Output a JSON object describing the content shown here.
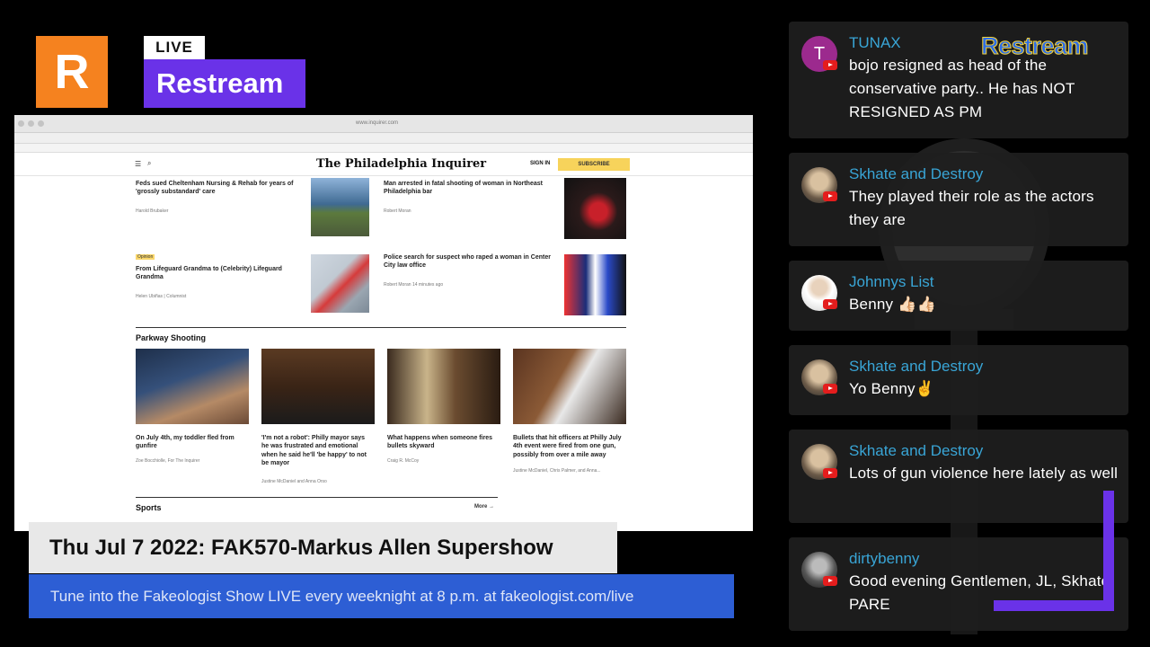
{
  "logo": {
    "letter": "R",
    "live": "LIVE",
    "name": "Restream"
  },
  "browser": {
    "url": "www.inquirer.com",
    "site_title": "The Philadelphia Inquirer",
    "signin": "SIGN IN",
    "subscribe": "SUBSCRIBE",
    "menu_icon": "hamburger-icon",
    "search_icon": "search-icon"
  },
  "articles": {
    "a1": {
      "title": "Feds sued Cheltenham Nursing & Rehab for years of 'grossly substandard' care",
      "byline": "Harold Brubaker"
    },
    "a2": {
      "title": "Man arrested in fatal shooting of woman in Northeast Philadelphia bar",
      "byline": "Robert Moran"
    },
    "a3": {
      "tag": "Opinion",
      "title": "From Lifeguard Grandma to (Celebrity) Lifeguard Grandma",
      "byline": "Helen Ubiñas | Columnist"
    },
    "a4": {
      "title": "Police search for suspect who raped a woman in Center City law office",
      "byline": "Robert Moran 14 minutes ago"
    }
  },
  "parkway": {
    "section": "Parkway Shooting",
    "items": [
      {
        "title": "On July 4th, my toddler fled from gunfire",
        "byline": "Zoe Bocchiolle, For The Inquirer"
      },
      {
        "title": "'I'm not a robot': Philly mayor says he was frustrated and emotional when he said he'll 'be happy' to not be mayor",
        "byline": "Justine McDaniel and Anna Orso"
      },
      {
        "title": "What happens when someone fires bullets skyward",
        "byline": "Craig R. McCoy"
      },
      {
        "title": "Bullets that hit officers at Philly July 4th event were fired from one gun, possibly from over a mile away",
        "byline": "Justine McDaniel, Chris Palmer, and Anna..."
      }
    ]
  },
  "sports": {
    "section": "Sports",
    "more": "More →"
  },
  "lower_third": {
    "title": "Thu Jul 7 2022: FAK570-Markus Allen Supershow",
    "ticker": "Tune into the Fakeologist Show LIVE every weeknight at 8 p.m. at fakeologist.com/live"
  },
  "chat": {
    "watermark": "Restream",
    "messages": [
      {
        "author": "TUNAX",
        "avatar_letter": "T",
        "avatar_color": "#9c2a8e",
        "text": "bojo resigned as head of the conservative party.. He has NOT RESIGNED AS PM"
      },
      {
        "author": "Skhate and Destroy",
        "text": "They played their role as the actors they are"
      },
      {
        "author": "Johnnys List",
        "text": "Benny 👍🏻👍🏻"
      },
      {
        "author": "Skhate and Destroy",
        "text": "Yo Benny✌"
      },
      {
        "author": "Skhate and Destroy",
        "text": "Lots of gun violence here lately as well"
      },
      {
        "author": "dirtybenny",
        "text": "Good evening Gentlemen, JL, Skhate, PARE"
      }
    ]
  },
  "colors": {
    "restream_orange": "#f5821f",
    "restream_purple": "#6a32e8",
    "ticker_blue": "#2d5ed4",
    "chat_author": "#39a5d6"
  }
}
